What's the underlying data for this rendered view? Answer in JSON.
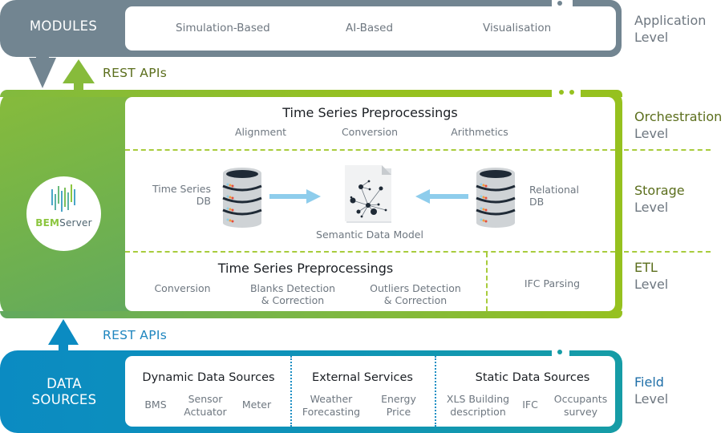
{
  "application_level": {
    "band_label": "MODULES",
    "modules": [
      "Simulation-Based",
      "AI-Based",
      "Visualisation"
    ],
    "level_name": "Application",
    "level_sub": "Level",
    "color": "#728591"
  },
  "rest_apis_top": "REST APIs",
  "rest_apis_bottom": "REST APIs",
  "core": {
    "logo": {
      "prefix": "BEM",
      "suffix": "Server"
    },
    "color": "#96c11f",
    "orchestration": {
      "title": "Time Series Preprocessings",
      "items": [
        "Alignment",
        "Conversion",
        "Arithmetics"
      ],
      "level_name": "Orchestration",
      "level_sub": "Level"
    },
    "storage": {
      "left_db_label_line1": "Time Series",
      "left_db_label_line2": "DB",
      "center_label": "Semantic Data Model",
      "right_db_label_line1": "Relational",
      "right_db_label_line2": "DB",
      "level_name": "Storage",
      "level_sub": "Level"
    },
    "etl": {
      "title": "Time Series Preprocessings",
      "items": [
        {
          "line1": "Conversion",
          "line2": ""
        },
        {
          "line1": "Blanks Detection",
          "line2": "& Correction"
        },
        {
          "line1": "Outliers Detection",
          "line2": "& Correction"
        }
      ],
      "side_item": "IFC Parsing",
      "level_name": "ETL",
      "level_sub": "Level"
    }
  },
  "field_level": {
    "band_label_line1": "DATA",
    "band_label_line2": "SOURCES",
    "color": "#0b8bc2",
    "groups": [
      {
        "title": "Dynamic Data Sources",
        "items": [
          {
            "line1": "BMS",
            "line2": ""
          },
          {
            "line1": "Sensor",
            "line2": "Actuator"
          },
          {
            "line1": "Meter",
            "line2": ""
          }
        ]
      },
      {
        "title": "External Services",
        "items": [
          {
            "line1": "Weather",
            "line2": "Forecasting"
          },
          {
            "line1": "Energy",
            "line2": "Price"
          }
        ]
      },
      {
        "title": "Static Data Sources",
        "items": [
          {
            "line1": "XLS Building",
            "line2": "description"
          },
          {
            "line1": "IFC",
            "line2": ""
          },
          {
            "line1": "Occupants",
            "line2": "survey"
          }
        ]
      }
    ],
    "level_name": "Field",
    "level_sub": "Level"
  }
}
